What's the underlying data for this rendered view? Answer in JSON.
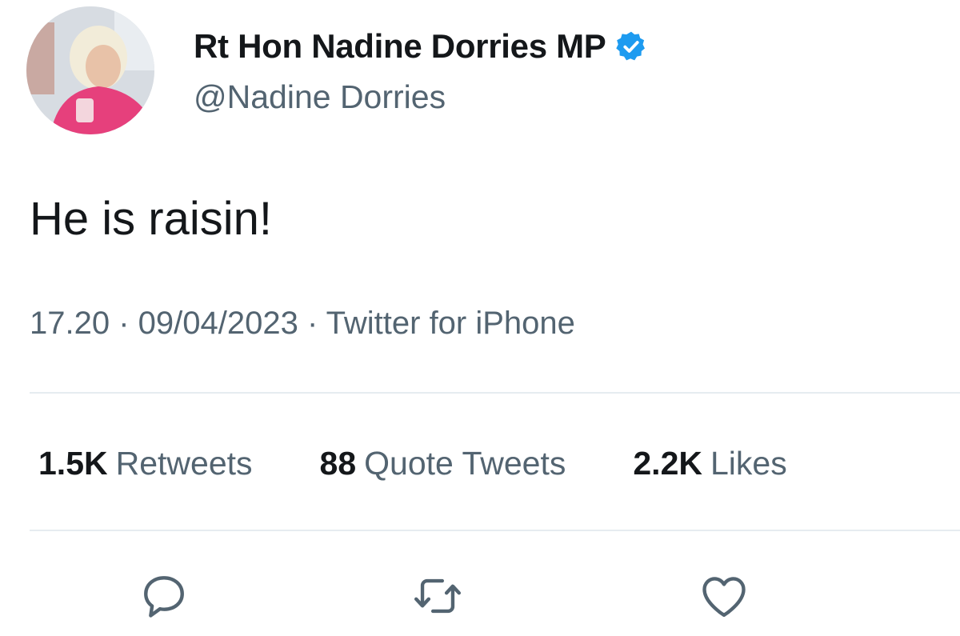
{
  "tweet": {
    "display_name": "Rt Hon Nadine Dorries MP",
    "handle": "@Nadine Dorries",
    "text": "He is raisin!",
    "timestamp": "17.20 · 09/04/2023 · Twitter for iPhone",
    "stats": {
      "retweets_count": "1.5K",
      "retweets_label": "Retweets",
      "quotes_count": "88",
      "quotes_label": "Quote Tweets",
      "likes_count": "2.2K",
      "likes_label": "Likes"
    }
  },
  "icons": {
    "verified": "verified-badge-icon",
    "reply": "reply-icon",
    "retweet": "retweet-icon",
    "like": "heart-icon"
  },
  "colors": {
    "verified_blue": "#1d9bf0",
    "text_primary": "#14171a",
    "text_secondary": "#536471",
    "divider": "#e6ecf0"
  }
}
